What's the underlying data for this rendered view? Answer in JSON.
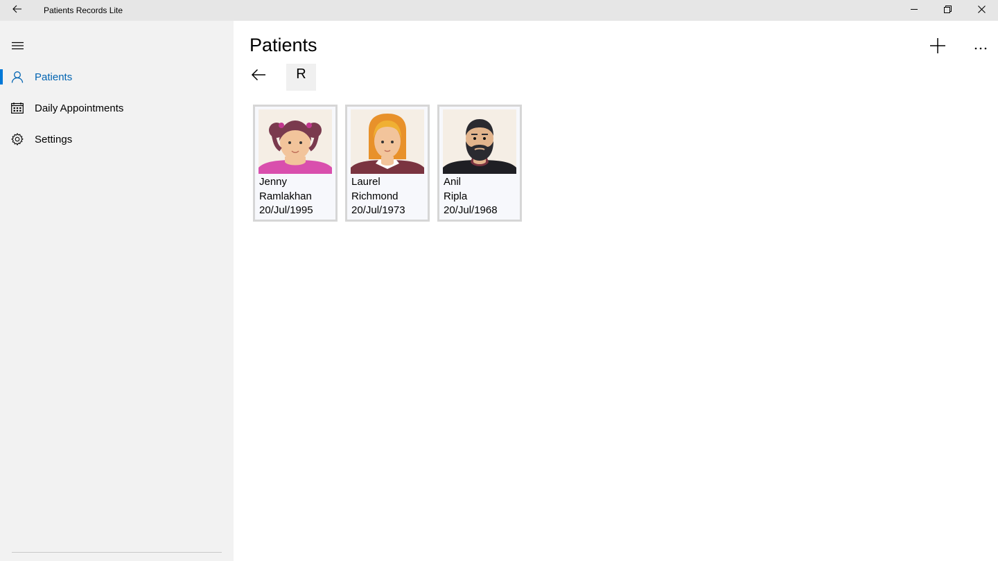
{
  "window": {
    "title": "Patients Records Lite",
    "back_icon": "back-arrow-icon",
    "minimize_icon": "minimize-icon",
    "restore_icon": "restore-icon",
    "close_icon": "close-icon"
  },
  "sidebar": {
    "menu_icon": "hamburger-icon",
    "items": [
      {
        "label": "Patients",
        "icon": "person-icon",
        "selected": true
      },
      {
        "label": "Daily Appointments",
        "icon": "calendar-icon",
        "selected": false
      },
      {
        "label": "Settings",
        "icon": "gear-icon",
        "selected": false
      }
    ],
    "accent_color": "#0078d7"
  },
  "main": {
    "title": "Patients",
    "add_icon": "plus-icon",
    "more_icon": "more-icon",
    "filter_letter": "R",
    "patients": [
      {
        "first_name": "Jenny",
        "last_name": "Ramlakhan",
        "dob": "20/Jul/1995",
        "avatar": "girl-avatar"
      },
      {
        "first_name": "Laurel",
        "last_name": "Richmond",
        "dob": "20/Jul/1973",
        "avatar": "woman-avatar"
      },
      {
        "first_name": "Anil",
        "last_name": "Ripla",
        "dob": "20/Jul/1968",
        "avatar": "bearded-man-avatar"
      }
    ]
  }
}
